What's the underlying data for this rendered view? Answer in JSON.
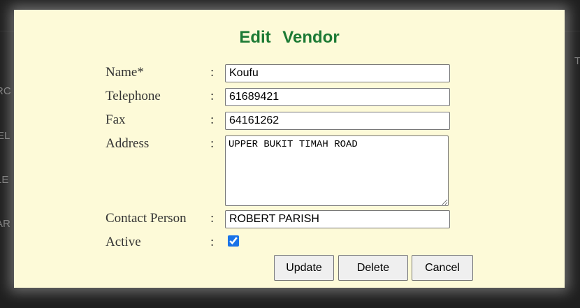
{
  "background": {
    "left_edge_chars": [
      "RC",
      "EL",
      "LE",
      "AR"
    ],
    "right_edge_char": "T"
  },
  "dialog": {
    "title": "Edit   Vendor",
    "colon": ":",
    "fields": {
      "name": {
        "label": "Name*",
        "value": "Koufu"
      },
      "telephone": {
        "label": "Telephone",
        "value": "61689421"
      },
      "fax": {
        "label": "Fax",
        "value": "64161262"
      },
      "address": {
        "label": "Address",
        "value": "UPPER BUKIT TIMAH ROAD"
      },
      "contact_person": {
        "label": "Contact Person",
        "value": "ROBERT PARISH"
      },
      "active": {
        "label": "Active",
        "checked": true
      }
    },
    "buttons": {
      "update": "Update",
      "delete": "Delete",
      "cancel": "Cancel"
    }
  },
  "colors": {
    "title": "#1c7a34",
    "dialog_background": "#fdfad8",
    "backdrop": "#1f1f1f"
  }
}
